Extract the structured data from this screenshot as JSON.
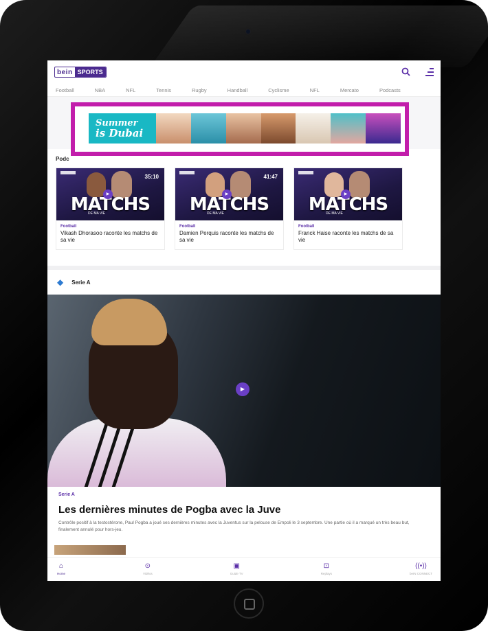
{
  "header": {
    "logo_bein": "bein",
    "logo_sports": "SPORTS"
  },
  "nav": [
    "Football",
    "NBA",
    "NFL",
    "Tennis",
    "Rugby",
    "Handball",
    "Cyclisme",
    "NFL",
    "Mercato",
    "Podcasts"
  ],
  "ad": {
    "line1": "Summer",
    "line2": "is Dubai"
  },
  "podcasts": {
    "title": "Podc",
    "cards": [
      {
        "duration": "35:10",
        "logo_text": "MATCHS",
        "sub": "DE MA VIE",
        "category": "Football",
        "title": "Vikash Dhorasoo raconte les matchs de sa vie"
      },
      {
        "duration": "41:47",
        "logo_text": "MATCHS",
        "sub": "DE MA VIE",
        "category": "Football",
        "title": "Damien Perquis raconte les matchs de sa vie"
      },
      {
        "duration": "",
        "logo_text": "MATCHS",
        "sub": "DE MA VIE",
        "category": "Football",
        "title": "Franck Haise raconte les matchs de sa vie"
      }
    ]
  },
  "serie": {
    "label": "Serie A"
  },
  "article": {
    "category": "Serie A",
    "title": "Les dernières minutes de Pogba avec la Juve",
    "summary": "Contrôle positif à la testostérone, Paul Pogba a joué ses dernières minutes avec la Juventus sur la pelouse de Empoli le 3 septembre. Une partie où il a marqué un très beau but, finalement annulé pour hors-jeu."
  },
  "bottom_nav": [
    {
      "label": "Home",
      "icon": "home-icon"
    },
    {
      "label": "Vidéos",
      "icon": "play-circle-icon"
    },
    {
      "label": "Guide TV",
      "icon": "tv-guide-icon"
    },
    {
      "label": "Replays",
      "icon": "replay-icon"
    },
    {
      "label": "beIN CONNECT",
      "icon": "live-icon"
    }
  ],
  "colors": {
    "brand": "#4b2b8f",
    "accent": "#6a3fc5",
    "ad_frame": "#c21dab"
  }
}
